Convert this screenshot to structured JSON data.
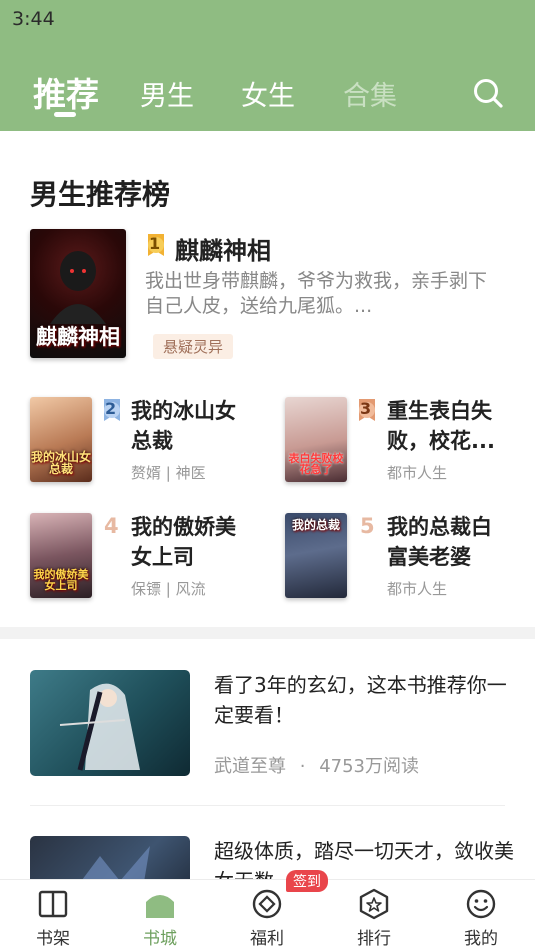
{
  "status": {
    "time": "3:44"
  },
  "tabs": [
    {
      "label": "推荐",
      "active": true
    },
    {
      "label": "男生"
    },
    {
      "label": "女生"
    },
    {
      "label": "合集"
    }
  ],
  "search": {
    "icon": "search-icon"
  },
  "ranking": {
    "title": "男生推荐榜",
    "top": {
      "rank": "1",
      "title": "麒麟神相",
      "cover_text": "麒麟神相",
      "description": "我出世身带麒麟，爷爷为救我，亲手剥下自己人皮，送给九尾狐。...",
      "tag": "悬疑灵异"
    },
    "items": [
      {
        "rank": "2",
        "title": "我的冰山女总裁",
        "meta": "赘婿 | 神医",
        "cover_text": "我的冰山女总裁"
      },
      {
        "rank": "3",
        "title": "重生表白失败，校花...",
        "meta": "都市人生",
        "cover_text": "表白失败校花急了"
      },
      {
        "rank": "4",
        "title": "我的傲娇美女上司",
        "meta": "保镖 | 风流",
        "cover_text": "我的傲娇美女上司"
      },
      {
        "rank": "5",
        "title": "我的总裁白富美老婆",
        "meta": "都市人生",
        "cover_text": "我的总裁"
      }
    ],
    "colors": {
      "rank1": "#f2b233",
      "rank2": "#8db3e2",
      "rank3": "#e39a72",
      "plain": "#e7b9a2"
    }
  },
  "feed": [
    {
      "text": "看了3年的玄幻，这本书推荐你一定要看！",
      "book": "武道至尊",
      "dot": "·",
      "reads": "4753万阅读"
    },
    {
      "text": "超级体质，踏尽一切天才，敛收美女无数",
      "book": "",
      "dot": "",
      "reads": ""
    }
  ],
  "bottom_nav": [
    {
      "label": "书架",
      "icon": "bookshelf-icon"
    },
    {
      "label": "书城",
      "icon": "bookstore-icon",
      "active": true
    },
    {
      "label": "福利",
      "icon": "welfare-icon",
      "badge": "签到"
    },
    {
      "label": "排行",
      "icon": "ranking-icon"
    },
    {
      "label": "我的",
      "icon": "profile-icon"
    }
  ],
  "theme": {
    "header_bg": "#8fbc82",
    "accent": "#6ea05e",
    "badge_red": "#e9454b"
  }
}
